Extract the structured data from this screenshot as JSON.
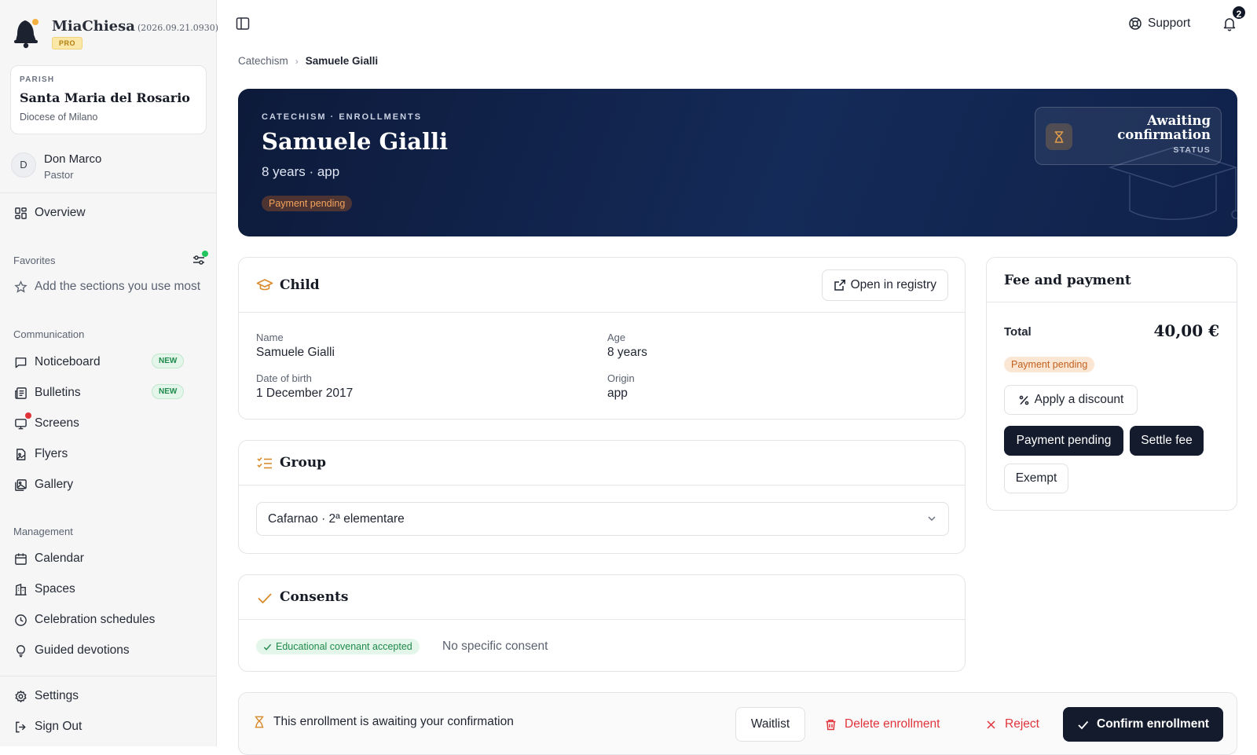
{
  "app": {
    "name": "MiaChiesa",
    "version": "(2026.09.21.0930)",
    "plan": "PRO"
  },
  "parish": {
    "kicker": "PARISH",
    "name": "Santa Maria del Rosario",
    "diocese": "Diocese of Milano"
  },
  "user": {
    "initial": "D",
    "name": "Don Marco",
    "role": "Pastor"
  },
  "sidebar": {
    "overview": "Overview",
    "favorites_label": "Favorites",
    "favorites_hint": "Add the sections you use most",
    "communication_label": "Communication",
    "communication": [
      {
        "label": "Noticeboard",
        "badge": "NEW"
      },
      {
        "label": "Bulletins",
        "badge": "NEW"
      },
      {
        "label": "Screens"
      },
      {
        "label": "Flyers"
      },
      {
        "label": "Gallery"
      }
    ],
    "management_label": "Management",
    "management": [
      {
        "label": "Calendar"
      },
      {
        "label": "Spaces"
      },
      {
        "label": "Celebration schedules"
      },
      {
        "label": "Guided devotions"
      }
    ],
    "settings": "Settings",
    "sign_out": "Sign Out"
  },
  "topbar": {
    "support": "Support",
    "notifications_count": "2"
  },
  "breadcrumb": {
    "parent": "Catechism",
    "current": "Samuele Gialli"
  },
  "hero": {
    "kicker": "CATECHISM · ENROLLMENTS",
    "title": "Samuele Gialli",
    "subtitle": "8 years · app",
    "badge": "Payment pending",
    "status_main": "Awaiting confirmation",
    "status_label": "STATUS"
  },
  "child": {
    "title": "Child",
    "open_registry": "Open in registry",
    "name_label": "Name",
    "name_value": "Samuele Gialli",
    "age_label": "Age",
    "age_value": "8 years",
    "dob_label": "Date of birth",
    "dob_value": "1 December 2017",
    "origin_label": "Origin",
    "origin_value": "app"
  },
  "group": {
    "title": "Group",
    "selected": "Cafarnao · 2ª elementare"
  },
  "consents": {
    "title": "Consents",
    "badge": "Educational covenant accepted",
    "note": "No specific consent"
  },
  "fee": {
    "title": "Fee and payment",
    "total_label": "Total",
    "total_value": "40,00 €",
    "badge": "Payment pending",
    "apply_discount": "Apply a discount",
    "payment_pending": "Payment pending",
    "settle_fee": "Settle fee",
    "exempt": "Exempt"
  },
  "actions": {
    "message": "This enrollment is awaiting your confirmation",
    "waitlist": "Waitlist",
    "delete": "Delete enrollment",
    "reject": "Reject",
    "confirm": "Confirm enrollment"
  },
  "colors": {
    "hero_bg": "#0d1a3a",
    "accent_orange": "#c2601e",
    "danger": "#e0343a",
    "success": "#1f8a4c",
    "dark_button": "#141b2d"
  }
}
